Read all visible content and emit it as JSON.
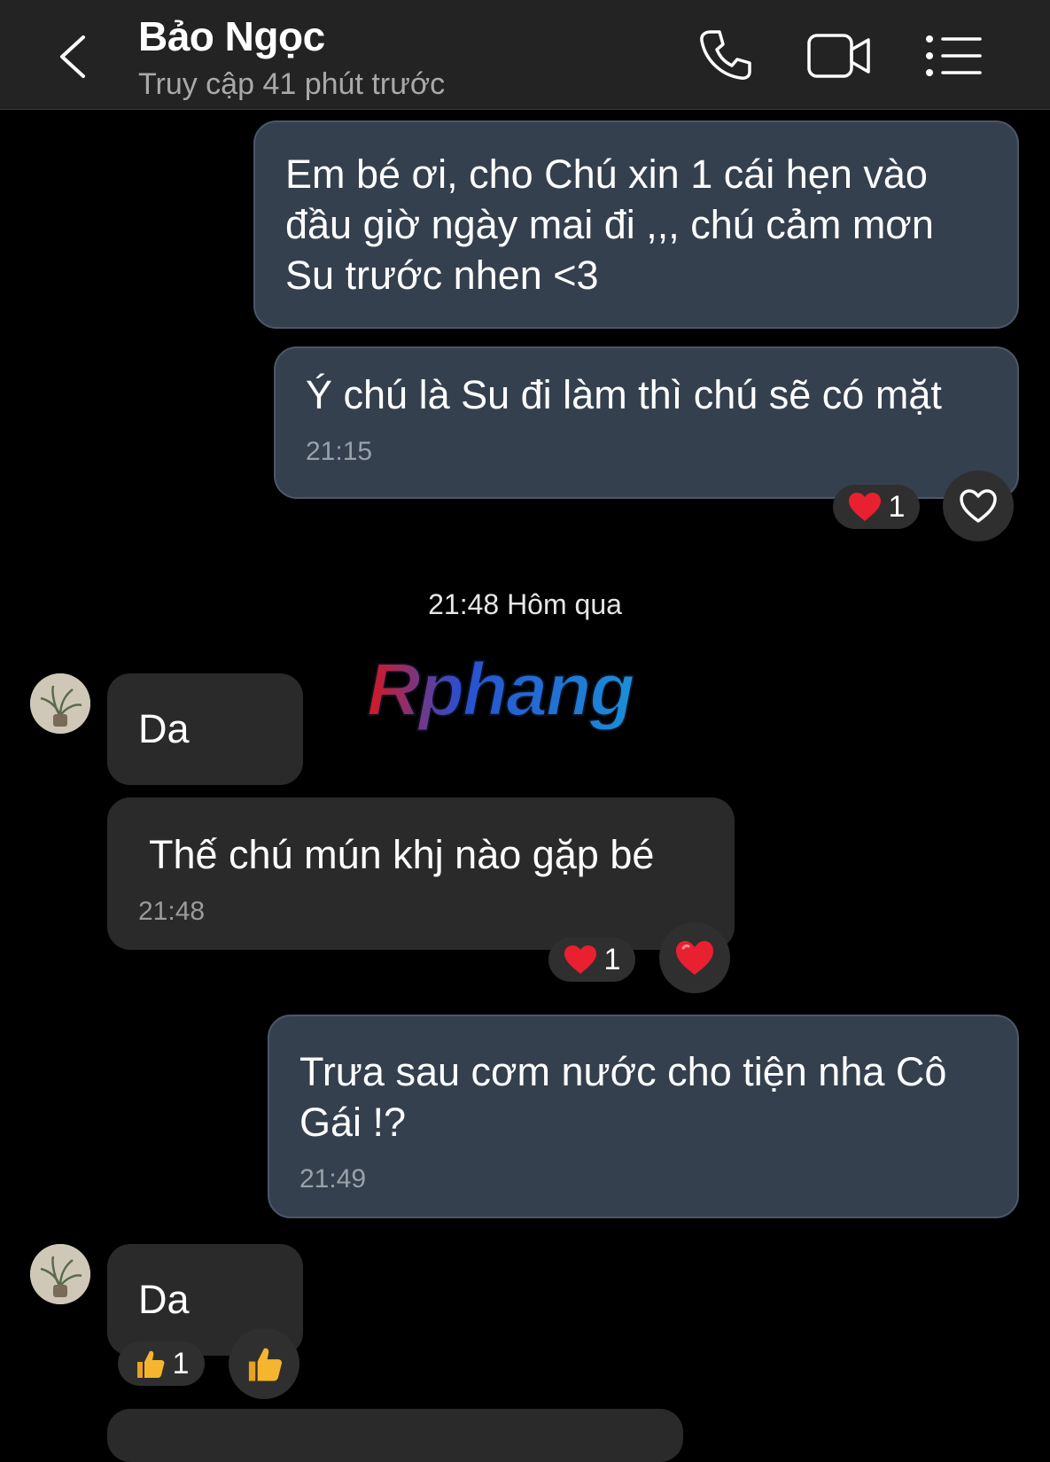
{
  "header": {
    "contact_name": "Bảo Ngọc",
    "last_seen": "Truy cập 41 phút trước",
    "icons": [
      "back-chevron-icon",
      "phone-icon",
      "video-call-icon",
      "menu-list-icon"
    ]
  },
  "messages": [
    {
      "direction": "outgoing",
      "text": "Em bé ơi, cho Chú xin 1 cái hẹn vào đầu giờ ngày mai đi ,,, chú cảm mơn Su trước nhen <3"
    },
    {
      "direction": "outgoing",
      "text": "Ý chú là Su đi làm thì chú sẽ có mặt",
      "time": "21:15",
      "reaction_count": "1",
      "reaction": "heart",
      "reaction_button": "heart-outline-icon"
    },
    {
      "direction": "incoming",
      "text": "Da"
    },
    {
      "direction": "incoming",
      "text": "Thế chú mún khj nào gặp bé",
      "time": "21:48",
      "reaction_count": "1",
      "reaction": "heart",
      "reaction_button": "heart-filled-icon"
    },
    {
      "direction": "outgoing",
      "text": "Trưa sau cơm nước cho tiện nha Cô Gái !?",
      "time": "21:49"
    },
    {
      "direction": "incoming",
      "text": "Da",
      "reaction_count": "1",
      "reaction": "thumbs-up",
      "reaction_button": "thumbs-up-icon"
    }
  ],
  "date_separator": "21:48 Hôm qua",
  "watermark": "Rphang",
  "colors": {
    "background": "#000000",
    "header": "#232323",
    "outgoing_bubble": "#34404e",
    "incoming_bubble": "#2a2a2a",
    "heart": "#e8202f",
    "thumbs": "#f5b52e"
  }
}
